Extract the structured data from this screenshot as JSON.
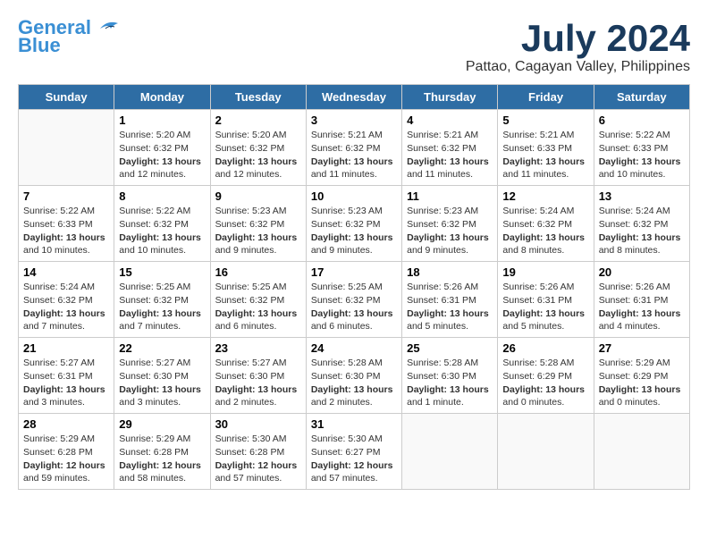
{
  "header": {
    "logo_general": "General",
    "logo_blue": "Blue",
    "month_title": "July 2024",
    "location": "Pattao, Cagayan Valley, Philippines"
  },
  "days_of_week": [
    "Sunday",
    "Monday",
    "Tuesday",
    "Wednesday",
    "Thursday",
    "Friday",
    "Saturday"
  ],
  "weeks": [
    [
      {
        "day": "",
        "info": ""
      },
      {
        "day": "1",
        "info": "Sunrise: 5:20 AM\nSunset: 6:32 PM\nDaylight: 13 hours\nand 12 minutes."
      },
      {
        "day": "2",
        "info": "Sunrise: 5:20 AM\nSunset: 6:32 PM\nDaylight: 13 hours\nand 12 minutes."
      },
      {
        "day": "3",
        "info": "Sunrise: 5:21 AM\nSunset: 6:32 PM\nDaylight: 13 hours\nand 11 minutes."
      },
      {
        "day": "4",
        "info": "Sunrise: 5:21 AM\nSunset: 6:32 PM\nDaylight: 13 hours\nand 11 minutes."
      },
      {
        "day": "5",
        "info": "Sunrise: 5:21 AM\nSunset: 6:33 PM\nDaylight: 13 hours\nand 11 minutes."
      },
      {
        "day": "6",
        "info": "Sunrise: 5:22 AM\nSunset: 6:33 PM\nDaylight: 13 hours\nand 10 minutes."
      }
    ],
    [
      {
        "day": "7",
        "info": "Sunrise: 5:22 AM\nSunset: 6:33 PM\nDaylight: 13 hours\nand 10 minutes."
      },
      {
        "day": "8",
        "info": "Sunrise: 5:22 AM\nSunset: 6:32 PM\nDaylight: 13 hours\nand 10 minutes."
      },
      {
        "day": "9",
        "info": "Sunrise: 5:23 AM\nSunset: 6:32 PM\nDaylight: 13 hours\nand 9 minutes."
      },
      {
        "day": "10",
        "info": "Sunrise: 5:23 AM\nSunset: 6:32 PM\nDaylight: 13 hours\nand 9 minutes."
      },
      {
        "day": "11",
        "info": "Sunrise: 5:23 AM\nSunset: 6:32 PM\nDaylight: 13 hours\nand 9 minutes."
      },
      {
        "day": "12",
        "info": "Sunrise: 5:24 AM\nSunset: 6:32 PM\nDaylight: 13 hours\nand 8 minutes."
      },
      {
        "day": "13",
        "info": "Sunrise: 5:24 AM\nSunset: 6:32 PM\nDaylight: 13 hours\nand 8 minutes."
      }
    ],
    [
      {
        "day": "14",
        "info": "Sunrise: 5:24 AM\nSunset: 6:32 PM\nDaylight: 13 hours\nand 7 minutes."
      },
      {
        "day": "15",
        "info": "Sunrise: 5:25 AM\nSunset: 6:32 PM\nDaylight: 13 hours\nand 7 minutes."
      },
      {
        "day": "16",
        "info": "Sunrise: 5:25 AM\nSunset: 6:32 PM\nDaylight: 13 hours\nand 6 minutes."
      },
      {
        "day": "17",
        "info": "Sunrise: 5:25 AM\nSunset: 6:32 PM\nDaylight: 13 hours\nand 6 minutes."
      },
      {
        "day": "18",
        "info": "Sunrise: 5:26 AM\nSunset: 6:31 PM\nDaylight: 13 hours\nand 5 minutes."
      },
      {
        "day": "19",
        "info": "Sunrise: 5:26 AM\nSunset: 6:31 PM\nDaylight: 13 hours\nand 5 minutes."
      },
      {
        "day": "20",
        "info": "Sunrise: 5:26 AM\nSunset: 6:31 PM\nDaylight: 13 hours\nand 4 minutes."
      }
    ],
    [
      {
        "day": "21",
        "info": "Sunrise: 5:27 AM\nSunset: 6:31 PM\nDaylight: 13 hours\nand 3 minutes."
      },
      {
        "day": "22",
        "info": "Sunrise: 5:27 AM\nSunset: 6:30 PM\nDaylight: 13 hours\nand 3 minutes."
      },
      {
        "day": "23",
        "info": "Sunrise: 5:27 AM\nSunset: 6:30 PM\nDaylight: 13 hours\nand 2 minutes."
      },
      {
        "day": "24",
        "info": "Sunrise: 5:28 AM\nSunset: 6:30 PM\nDaylight: 13 hours\nand 2 minutes."
      },
      {
        "day": "25",
        "info": "Sunrise: 5:28 AM\nSunset: 6:30 PM\nDaylight: 13 hours\nand 1 minute."
      },
      {
        "day": "26",
        "info": "Sunrise: 5:28 AM\nSunset: 6:29 PM\nDaylight: 13 hours\nand 0 minutes."
      },
      {
        "day": "27",
        "info": "Sunrise: 5:29 AM\nSunset: 6:29 PM\nDaylight: 13 hours\nand 0 minutes."
      }
    ],
    [
      {
        "day": "28",
        "info": "Sunrise: 5:29 AM\nSunset: 6:28 PM\nDaylight: 12 hours\nand 59 minutes."
      },
      {
        "day": "29",
        "info": "Sunrise: 5:29 AM\nSunset: 6:28 PM\nDaylight: 12 hours\nand 58 minutes."
      },
      {
        "day": "30",
        "info": "Sunrise: 5:30 AM\nSunset: 6:28 PM\nDaylight: 12 hours\nand 57 minutes."
      },
      {
        "day": "31",
        "info": "Sunrise: 5:30 AM\nSunset: 6:27 PM\nDaylight: 12 hours\nand 57 minutes."
      },
      {
        "day": "",
        "info": ""
      },
      {
        "day": "",
        "info": ""
      },
      {
        "day": "",
        "info": ""
      }
    ]
  ]
}
